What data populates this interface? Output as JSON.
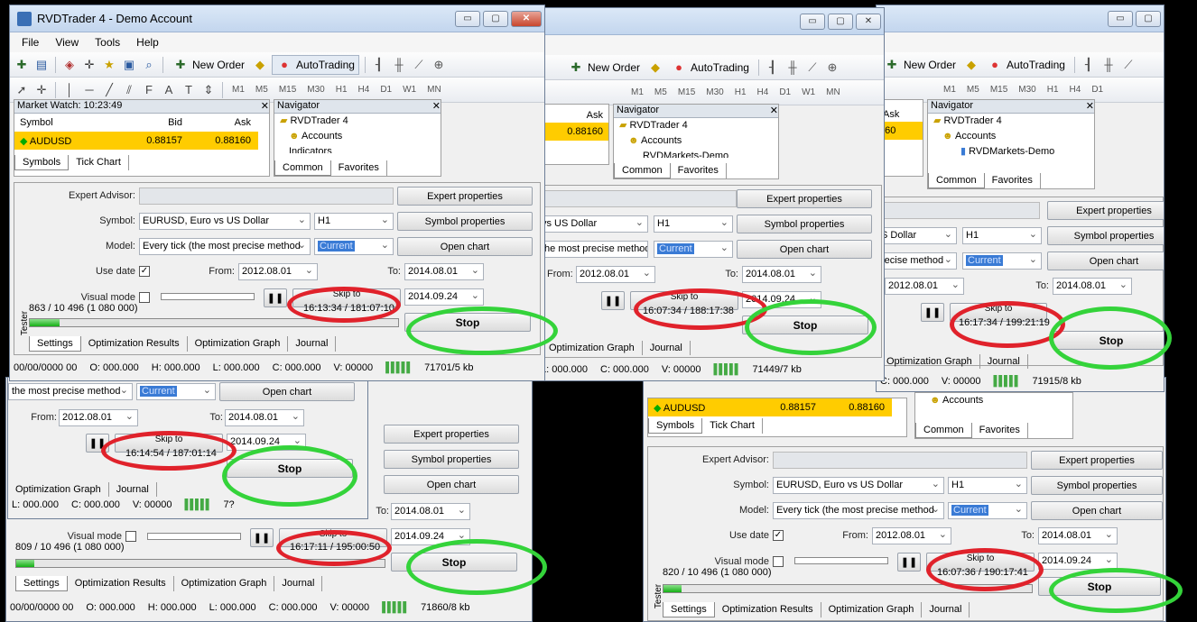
{
  "window": {
    "title": "RVDTrader 4 - Demo Account",
    "min_glyph": "▭",
    "max_glyph": "▢",
    "close_glyph": "✕"
  },
  "menu": [
    "File",
    "View",
    "Tools",
    "Help"
  ],
  "toolbar": {
    "new_order": "New Order",
    "autotrading": "AutoTrading",
    "timeframes": [
      "M1",
      "M5",
      "M15",
      "M30",
      "H1",
      "H4",
      "D1",
      "W1",
      "MN"
    ]
  },
  "market_watch": {
    "title": "Market Watch: 10:23:49",
    "col_symbol": "Symbol",
    "col_bid": "Bid",
    "col_ask": "Ask",
    "row_symbol": "AUDUSD",
    "row_bid": "0.88157",
    "row_ask": "0.88160",
    "tab_symbols": "Symbols",
    "tab_tick_chart": "Tick Chart"
  },
  "navigator": {
    "title": "Navigator",
    "root": "RVDTrader 4",
    "accounts": "Accounts",
    "indicators": "Indicators",
    "account_item": "RVDMarkets-Demo",
    "tab_common": "Common",
    "tab_favorites": "Favorites"
  },
  "tester": {
    "side_label": "Tester",
    "expert_advisor_label": "Expert Advisor:",
    "symbol_label": "Symbol:",
    "symbol_value": "EURUSD, Euro vs US Dollar",
    "period_value": "H1",
    "model_label": "Model:",
    "model_value": "Every tick (the most precise method",
    "model_value_short": "the most precise method",
    "spread_value": "Current",
    "use_date_label": "Use date",
    "from_label": "From:",
    "from_value": "2012.08.01",
    "to_label": "To:",
    "to_value": "2014.08.01",
    "skip_date": "2014.09.24",
    "visual_mode_label": "Visual mode",
    "skip_to_label": "Skip to",
    "expert_properties": "Expert properties",
    "symbol_properties": "Symbol properties",
    "open_chart": "Open chart",
    "stop": "Stop",
    "tabs": [
      "Settings",
      "Optimization Results",
      "Optimization Graph",
      "Journal"
    ],
    "checkmark": "✓"
  },
  "instances": [
    {
      "counter": "863 / 10 496 (1 080 000)",
      "time": "16:13:34 / 181:07:10",
      "progress": 0.08,
      "mem": "71701/5 kb"
    },
    {
      "counter": "",
      "time": "16:07:34 / 188:17:38",
      "progress": 0.0,
      "mem": "71449/7 kb"
    },
    {
      "counter": "",
      "time": "16:17:34 / 199:21:19",
      "progress": 0.0,
      "mem": "71915/8 kb"
    },
    {
      "counter": "",
      "time": "16:14:54 / 187:01:14",
      "progress": 0.0,
      "mem": "7?"
    },
    {
      "counter": "809 / 10 496 (1 080 000)",
      "time": "16:17:11 / 195:00:50",
      "progress": 0.05,
      "mem": "71860/8 kb"
    },
    {
      "counter": "820 / 10 496 (1 080 000)",
      "time": "16:07:36 / 190:17:41",
      "progress": 0.05,
      "mem": ""
    }
  ],
  "status_bar": {
    "date": "00/00/0000 00",
    "open": "O: 000.000",
    "high": "H: 000.000",
    "low": "L: 000.000",
    "close": "C: 000.000",
    "volume": "V: 00000"
  },
  "colors": {
    "highlight_rings": "#e0222b",
    "stop_rings": "#34d33a",
    "selected_row": "#ffcc00",
    "progress_fill": "#15b015"
  }
}
